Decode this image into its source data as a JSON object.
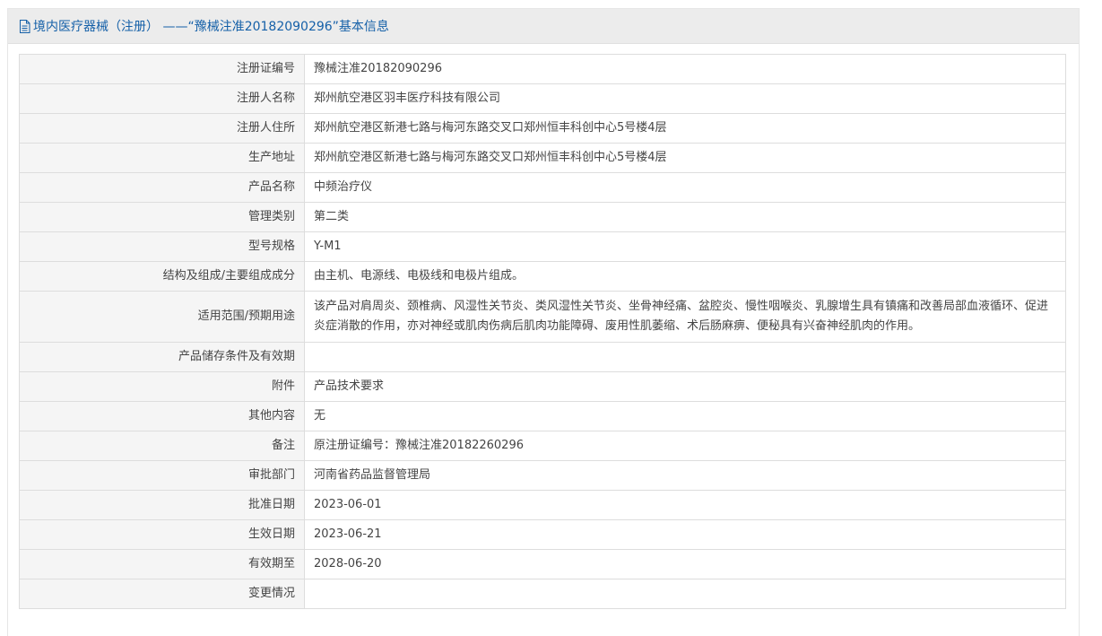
{
  "header": {
    "icon": "document-icon",
    "title": "境内医疗器械（注册） ——“豫械注准20182090296”基本信息"
  },
  "colors": {
    "header_text": "#1560a8",
    "header_bg": "#ececec",
    "label_bg": "#f5f5f5",
    "border": "#dddddd"
  },
  "rows": [
    {
      "label": "注册证编号",
      "value": "豫械注准20182090296"
    },
    {
      "label": "注册人名称",
      "value": "郑州航空港区羽丰医疗科技有限公司"
    },
    {
      "label": "注册人住所",
      "value": "郑州航空港区新港七路与梅河东路交叉口郑州恒丰科创中心5号楼4层"
    },
    {
      "label": "生产地址",
      "value": "郑州航空港区新港七路与梅河东路交叉口郑州恒丰科创中心5号楼4层"
    },
    {
      "label": "产品名称",
      "value": "中频治疗仪"
    },
    {
      "label": "管理类别",
      "value": "第二类"
    },
    {
      "label": "型号规格",
      "value": "Y-M1"
    },
    {
      "label": "结构及组成/主要组成成分",
      "value": "由主机、电源线、电极线和电极片组成。"
    },
    {
      "label": "适用范围/预期用途",
      "value": "该产品对肩周炎、颈椎病、风湿性关节炎、类风湿性关节炎、坐骨神经痛、盆腔炎、慢性咽喉炎、乳腺增生具有镇痛和改善局部血液循环、促进炎症消散的作用，亦对神经或肌肉伤病后肌肉功能障碍、废用性肌萎缩、术后肠麻痹、便秘具有兴奋神经肌肉的作用。"
    },
    {
      "label": "产品储存条件及有效期",
      "value": ""
    },
    {
      "label": "附件",
      "value": "产品技术要求"
    },
    {
      "label": "其他内容",
      "value": "无"
    },
    {
      "label": "备注",
      "value": "原注册证编号：豫械注准20182260296"
    },
    {
      "label": "审批部门",
      "value": "河南省药品监督管理局"
    },
    {
      "label": "批准日期",
      "value": "2023-06-01"
    },
    {
      "label": "生效日期",
      "value": "2023-06-21"
    },
    {
      "label": "有效期至",
      "value": "2028-06-20"
    },
    {
      "label": "变更情况",
      "value": ""
    }
  ]
}
